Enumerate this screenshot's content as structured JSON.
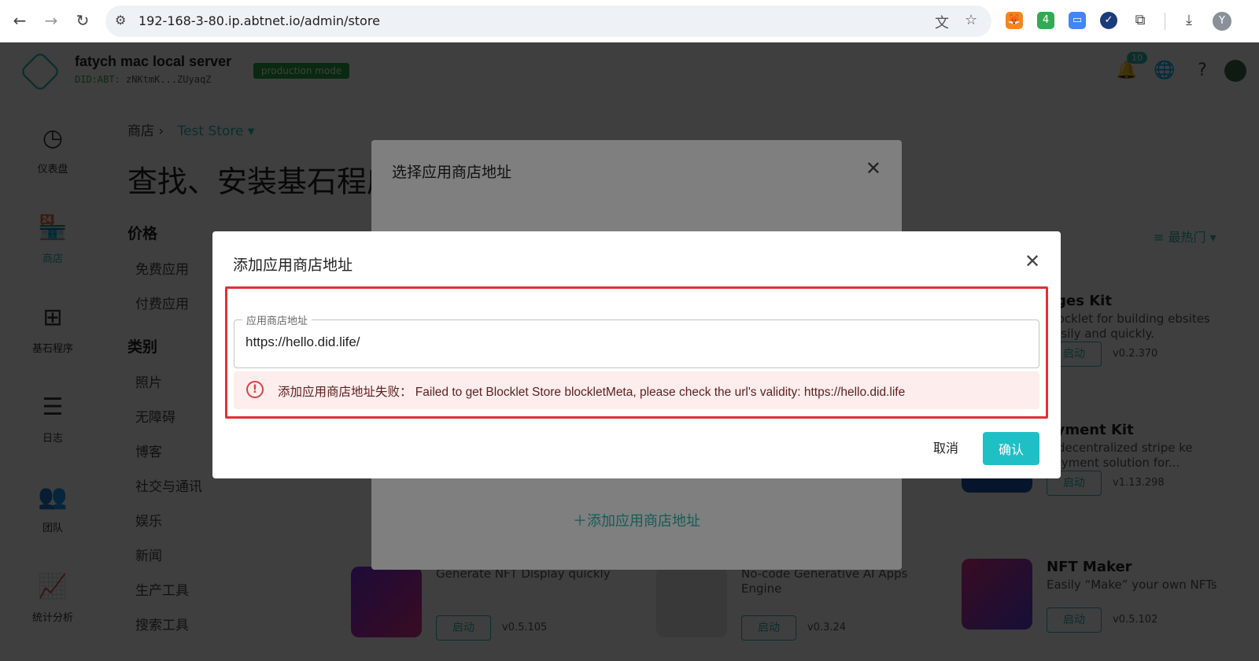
{
  "browser": {
    "url": "192-168-3-80.ip.abtnet.io/admin/store",
    "profile_initial": "Y",
    "ext_badge": "4"
  },
  "header": {
    "server_name": "fatych mac local server",
    "did_prefix": "DID:ABT:",
    "did_value": "zNKtmK...ZUyaqZ",
    "mode_badge": "production mode",
    "notification_count": "10"
  },
  "sidebar": {
    "items": [
      {
        "label": "仪表盘",
        "icon": "dashboard-icon"
      },
      {
        "label": "商店",
        "icon": "store-icon",
        "active": true
      },
      {
        "label": "基石程序",
        "icon": "blocklets-icon"
      },
      {
        "label": "日志",
        "icon": "logs-icon"
      },
      {
        "label": "团队",
        "icon": "team-icon"
      },
      {
        "label": "统计分析",
        "icon": "analytics-icon"
      }
    ]
  },
  "breadcrumb": {
    "root": "商店",
    "current": "Test Store"
  },
  "page": {
    "title": "查找、安装基石程序"
  },
  "filters": {
    "price_heading": "价格",
    "price_items": [
      "免费应用",
      "付费应用"
    ],
    "category_heading": "类别",
    "category_items": [
      "照片",
      "无障碍",
      "博客",
      "社交与通讯",
      "娱乐",
      "新闻",
      "生产工具",
      "搜索工具"
    ]
  },
  "sort": {
    "label": "最热门"
  },
  "cards": [
    {
      "title": "ages Kit",
      "desc": "blocklet for building ebsites easily and quickly.",
      "launch": "启动",
      "version": "v0.2.370"
    },
    {
      "title": "ayment Kit",
      "desc": "e decentralized stripe ke payment solution for...",
      "launch": "启动",
      "version": "v1.13.298"
    },
    {
      "title": "",
      "desc": "Generate NFT Display quickly",
      "launch": "启动",
      "version": "v0.5.105"
    },
    {
      "title": "",
      "desc": "No-code Generative AI Apps Engine",
      "launch": "启动",
      "version": "v0.3.24"
    },
    {
      "title": "NFT Maker",
      "desc": "Easily “Make” your own NFTs",
      "launch": "启动",
      "version": "v0.5.102"
    }
  ],
  "dialog_back": {
    "title": "选择应用商店地址",
    "add_link": "添加应用商店地址"
  },
  "dialog": {
    "title": "添加应用商店地址",
    "field_label": "应用商店地址",
    "field_value": "https://hello.did.life/",
    "error_text": "添加应用商店地址失败： Failed to get Blocklet Store blockletMeta, please check the url's validity: https://hello.did.life",
    "cancel_label": "取消",
    "confirm_label": "确认"
  },
  "colors": {
    "accent": "#2ab8b0",
    "confirm_button": "#1fbfc6",
    "error_border": "#e03035",
    "error_bg": "#fdeded",
    "production_badge": "#27a647"
  }
}
